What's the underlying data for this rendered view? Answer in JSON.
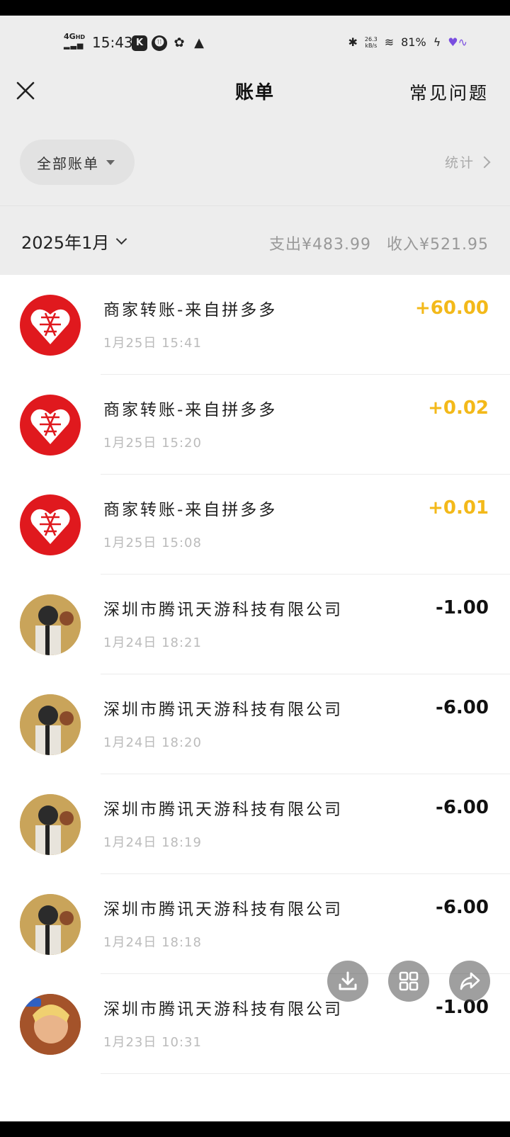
{
  "status": {
    "network": "4G",
    "network_hd": "HD",
    "time": "15:43",
    "speed": "26.3",
    "speed_unit": "kB/s",
    "battery": "81%"
  },
  "nav": {
    "title": "账单",
    "faq": "常见问题"
  },
  "filter": {
    "label": "全部账单",
    "stats": "统计"
  },
  "month": {
    "label": "2025年1月",
    "summary_expense": "支出¥483.99",
    "summary_income": "收入¥521.95"
  },
  "transactions": [
    {
      "title": "商家转账-来自拼多多",
      "time": "1月25日 15:41",
      "amount": "+60.00",
      "avatar": "pinduoduo-logo"
    },
    {
      "title": "商家转账-来自拼多多",
      "time": "1月25日 15:20",
      "amount": "+0.02",
      "avatar": "pinduoduo-logo"
    },
    {
      "title": "商家转账-来自拼多多",
      "time": "1月25日 15:08",
      "amount": "+0.01",
      "avatar": "pinduoduo-logo"
    },
    {
      "title": "深圳市腾讯天游科技有限公司",
      "time": "1月24日 18:21",
      "amount": "-1.00",
      "avatar": "pubg-avatar"
    },
    {
      "title": "深圳市腾讯天游科技有限公司",
      "time": "1月24日 18:20",
      "amount": "-6.00",
      "avatar": "pubg-avatar"
    },
    {
      "title": "深圳市腾讯天游科技有限公司",
      "time": "1月24日 18:19",
      "amount": "-6.00",
      "avatar": "pubg-avatar"
    },
    {
      "title": "深圳市腾讯天游科技有限公司",
      "time": "1月24日 18:18",
      "amount": "-6.00",
      "avatar": "pubg-avatar"
    },
    {
      "title": "深圳市腾讯天游科技有限公司",
      "time": "1月23日 10:31",
      "amount": "-1.00",
      "avatar": "honor-of-kings-avatar"
    }
  ],
  "colors": {
    "income": "#f3b91a",
    "expense": "#111111",
    "pdd_red": "#e0191e",
    "header_bg": "#ededed"
  },
  "fabs": [
    "download-icon",
    "grid-icon",
    "share-icon"
  ]
}
